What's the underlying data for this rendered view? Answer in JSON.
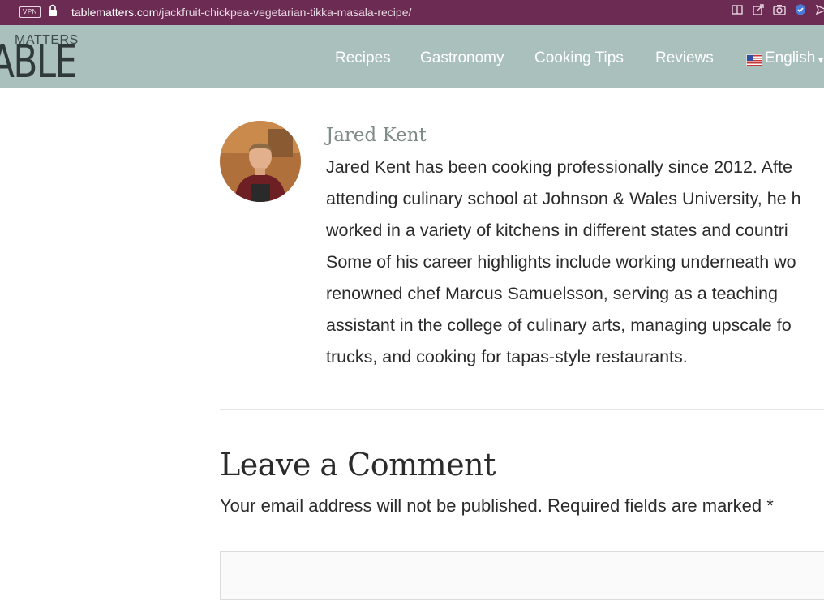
{
  "browser": {
    "vpn_label": "VPN",
    "url_domain": "tablematters.com",
    "url_path": "/jackfruit-chickpea-vegetarian-tikka-masala-recipe/",
    "colors": {
      "bar": "#6b2b53"
    }
  },
  "header": {
    "logo_top": "MATTERS",
    "logo_main": "ABLE",
    "nav": [
      "Recipes",
      "Gastronomy",
      "Cooking Tips",
      "Reviews"
    ],
    "language": "English",
    "colors": {
      "background": "#a9c0bc",
      "text": "#ffffff"
    }
  },
  "author": {
    "name": "Jared Kent",
    "bio_lines": [
      "Jared Kent has been cooking professionally since 2012. Afte",
      "attending culinary school at Johnson & Wales University, he h",
      "worked in a variety of kitchens in different states and countri",
      "Some of his career highlights include working underneath wo",
      "renowned chef Marcus Samuelsson, serving as a teaching",
      "assistant in the college of culinary arts, managing upscale fo",
      "trucks, and cooking for tapas-style restaurants."
    ]
  },
  "comments": {
    "title": "Leave a Comment",
    "notice": "Your email address will not be published. Required fields are marked",
    "required_marker": "*"
  }
}
